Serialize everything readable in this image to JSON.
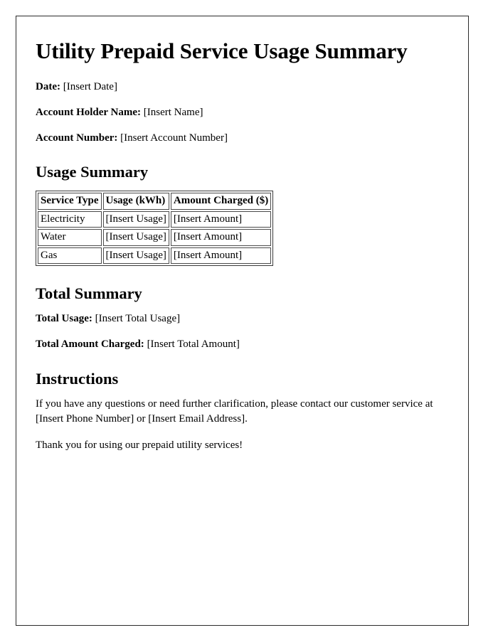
{
  "document": {
    "title": "Utility Prepaid Service Usage Summary",
    "header_fields": [
      {
        "label": "Date:",
        "value": "[Insert Date]"
      },
      {
        "label": "Account Holder Name:",
        "value": "[Insert Name]"
      },
      {
        "label": "Account Number:",
        "value": "[Insert Account Number]"
      }
    ],
    "usage_section": {
      "heading": "Usage Summary",
      "table": {
        "columns": [
          "Service Type",
          "Usage (kWh)",
          "Amount Charged ($)"
        ],
        "rows": [
          [
            "Electricity",
            "[Insert Usage]",
            "[Insert Amount]"
          ],
          [
            "Water",
            "[Insert Usage]",
            "[Insert Amount]"
          ],
          [
            "Gas",
            "[Insert Usage]",
            "[Insert Amount]"
          ]
        ]
      }
    },
    "total_section": {
      "heading": "Total Summary",
      "fields": [
        {
          "label": "Total Usage:",
          "value": "[Insert Total Usage]"
        },
        {
          "label": "Total Amount Charged:",
          "value": "[Insert Total Amount]"
        }
      ]
    },
    "instructions_section": {
      "heading": "Instructions",
      "paragraphs": [
        "If you have any questions or need further clarification, please contact our customer service at [Insert Phone Number] or [Insert Email Address].",
        "Thank you for using our prepaid utility services!"
      ]
    }
  }
}
